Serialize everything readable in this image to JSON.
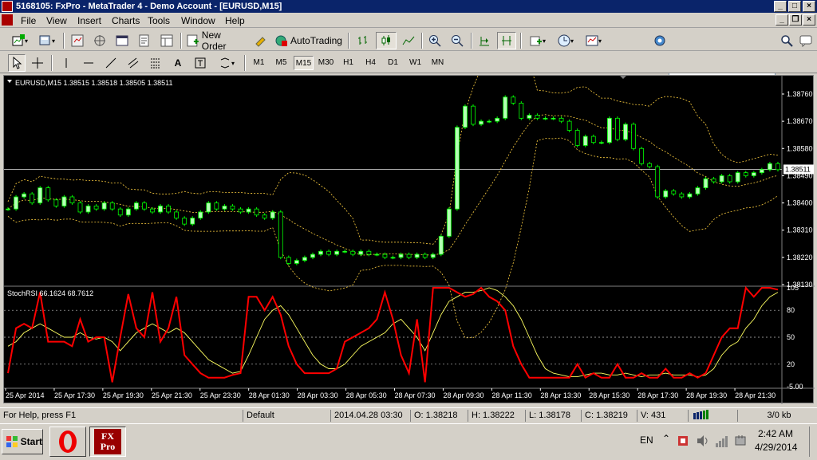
{
  "window": {
    "title": "5168105: FxPro - MetaTrader 4 - Demo Account - [EURUSD,M15]"
  },
  "menu": [
    "File",
    "View",
    "Insert",
    "Charts",
    "Tools",
    "Window",
    "Help"
  ],
  "toolbar": {
    "new_order": "New Order",
    "autotrading": "AutoTrading",
    "search_placeholder": ""
  },
  "timeframes": [
    "M1",
    "M5",
    "M15",
    "M30",
    "H1",
    "H4",
    "D1",
    "W1",
    "MN"
  ],
  "active_timeframe": "M15",
  "chart": {
    "header": "EURUSD,M15  1.38515 1.38518 1.38505 1.38511",
    "current_price": "1.38511",
    "price_ticks": [
      "1.38760",
      "1.38670",
      "1.38580",
      "1.38490",
      "1.38400",
      "1.38310",
      "1.38220",
      "1.38130"
    ],
    "indicator_header": "StochRSI 66.1624 68.7612",
    "indicator_ticks": [
      "105",
      "80",
      "50",
      "20",
      "-5.00"
    ],
    "time_ticks": [
      "25 Apr 2014",
      "25 Apr 17:30",
      "25 Apr 19:30",
      "25 Apr 21:30",
      "25 Apr 23:30",
      "28 Apr 01:30",
      "28 Apr 03:30",
      "28 Apr 05:30",
      "28 Apr 07:30",
      "28 Apr 09:30",
      "28 Apr 11:30",
      "28 Apr 13:30",
      "28 Apr 15:30",
      "28 Apr 17:30",
      "28 Apr 19:30",
      "28 Apr 21:30"
    ],
    "colors": {
      "bull": "#b4ffb4",
      "bear": "#00ff00",
      "bands": "#ffd040",
      "stoch": "#ff0000",
      "signal": "#ffff60"
    }
  },
  "chart_data": {
    "type": "line",
    "title": "EURUSD,M15",
    "xlabel": "",
    "ylabel": "",
    "ylim": [
      1.3813,
      1.3881
    ],
    "close": [
      1.3838,
      1.3842,
      1.3843,
      1.384,
      1.3845,
      1.3841,
      1.3839,
      1.3842,
      1.384,
      1.3837,
      1.3839,
      1.3838,
      1.384,
      1.3838,
      1.3836,
      1.3838,
      1.384,
      1.3838,
      1.3837,
      1.3839,
      1.3837,
      1.3835,
      1.3833,
      1.3835,
      1.3837,
      1.384,
      1.3838,
      1.3839,
      1.3838,
      1.3837,
      1.3838,
      1.3836,
      1.3835,
      1.3837,
      1.3822,
      1.382,
      1.3821,
      1.3822,
      1.3823,
      1.3824,
      1.3823,
      1.3824,
      1.3824,
      1.3823,
      1.3824,
      1.3823,
      1.3823,
      1.3822,
      1.3822,
      1.3823,
      1.3822,
      1.3823,
      1.3822,
      1.3823,
      1.3829,
      1.3838,
      1.3865,
      1.3872,
      1.3866,
      1.3867,
      1.3867,
      1.3868,
      1.3875,
      1.3873,
      1.3868,
      1.3869,
      1.3868,
      1.3868,
      1.3868,
      1.3867,
      1.3864,
      1.3859,
      1.3862,
      1.386,
      1.386,
      1.3868,
      1.3861,
      1.3866,
      1.3858,
      1.3853,
      1.3852,
      1.3842,
      1.3844,
      1.3843,
      1.3842,
      1.3843,
      1.3845,
      1.3848,
      1.3847,
      1.3849,
      1.3847,
      1.385,
      1.3849,
      1.385,
      1.3851,
      1.3853,
      1.3851
    ],
    "stoch_k": [
      10,
      60,
      65,
      60,
      100,
      45,
      45,
      45,
      40,
      70,
      45,
      50,
      50,
      0,
      50,
      98,
      60,
      50,
      100,
      45,
      60,
      95,
      30,
      20,
      10,
      5,
      5,
      5,
      8,
      10,
      95,
      95,
      80,
      95,
      75,
      40,
      20,
      10,
      10,
      10,
      10,
      15,
      45,
      50,
      55,
      60,
      70,
      100,
      70,
      30,
      10,
      70,
      0,
      105,
      105,
      105,
      100,
      95,
      98,
      105,
      95,
      90,
      80,
      40,
      20,
      5,
      5,
      5,
      5,
      5,
      5,
      20,
      5,
      10,
      5,
      5,
      20,
      5,
      5,
      10,
      5,
      5,
      15,
      5,
      5,
      10,
      5,
      10,
      30,
      50,
      60,
      60,
      105,
      95,
      105,
      105,
      103
    ],
    "stoch_d": [
      40,
      45,
      55,
      60,
      65,
      60,
      55,
      50,
      50,
      55,
      50,
      48,
      50,
      45,
      35,
      45,
      55,
      60,
      65,
      60,
      55,
      60,
      55,
      45,
      35,
      25,
      20,
      15,
      10,
      12,
      30,
      50,
      70,
      80,
      85,
      75,
      60,
      45,
      30,
      20,
      15,
      15,
      20,
      30,
      40,
      45,
      50,
      55,
      65,
      70,
      60,
      50,
      35,
      55,
      75,
      90,
      95,
      100,
      100,
      102,
      105,
      102,
      95,
      85,
      70,
      50,
      30,
      15,
      10,
      8,
      6,
      6,
      8,
      10,
      10,
      8,
      8,
      10,
      8,
      6,
      8,
      8,
      10,
      8,
      8,
      8,
      6,
      8,
      15,
      30,
      40,
      45,
      60,
      70,
      85,
      95,
      100
    ]
  },
  "statusbar": {
    "help": "For Help, press F1",
    "profile": "Default",
    "datetime": "2014.04.28 03:30",
    "open": "O: 1.38218",
    "high": "H: 1.38222",
    "low": "L: 1.38178",
    "close": "C: 1.38219",
    "volume": "V: 431",
    "traffic": "3/0 kb"
  },
  "taskbar": {
    "start": "Start",
    "lang": "EN",
    "time": "2:42 AM",
    "date": "4/29/2014",
    "fx_logo": "FX Pro"
  }
}
